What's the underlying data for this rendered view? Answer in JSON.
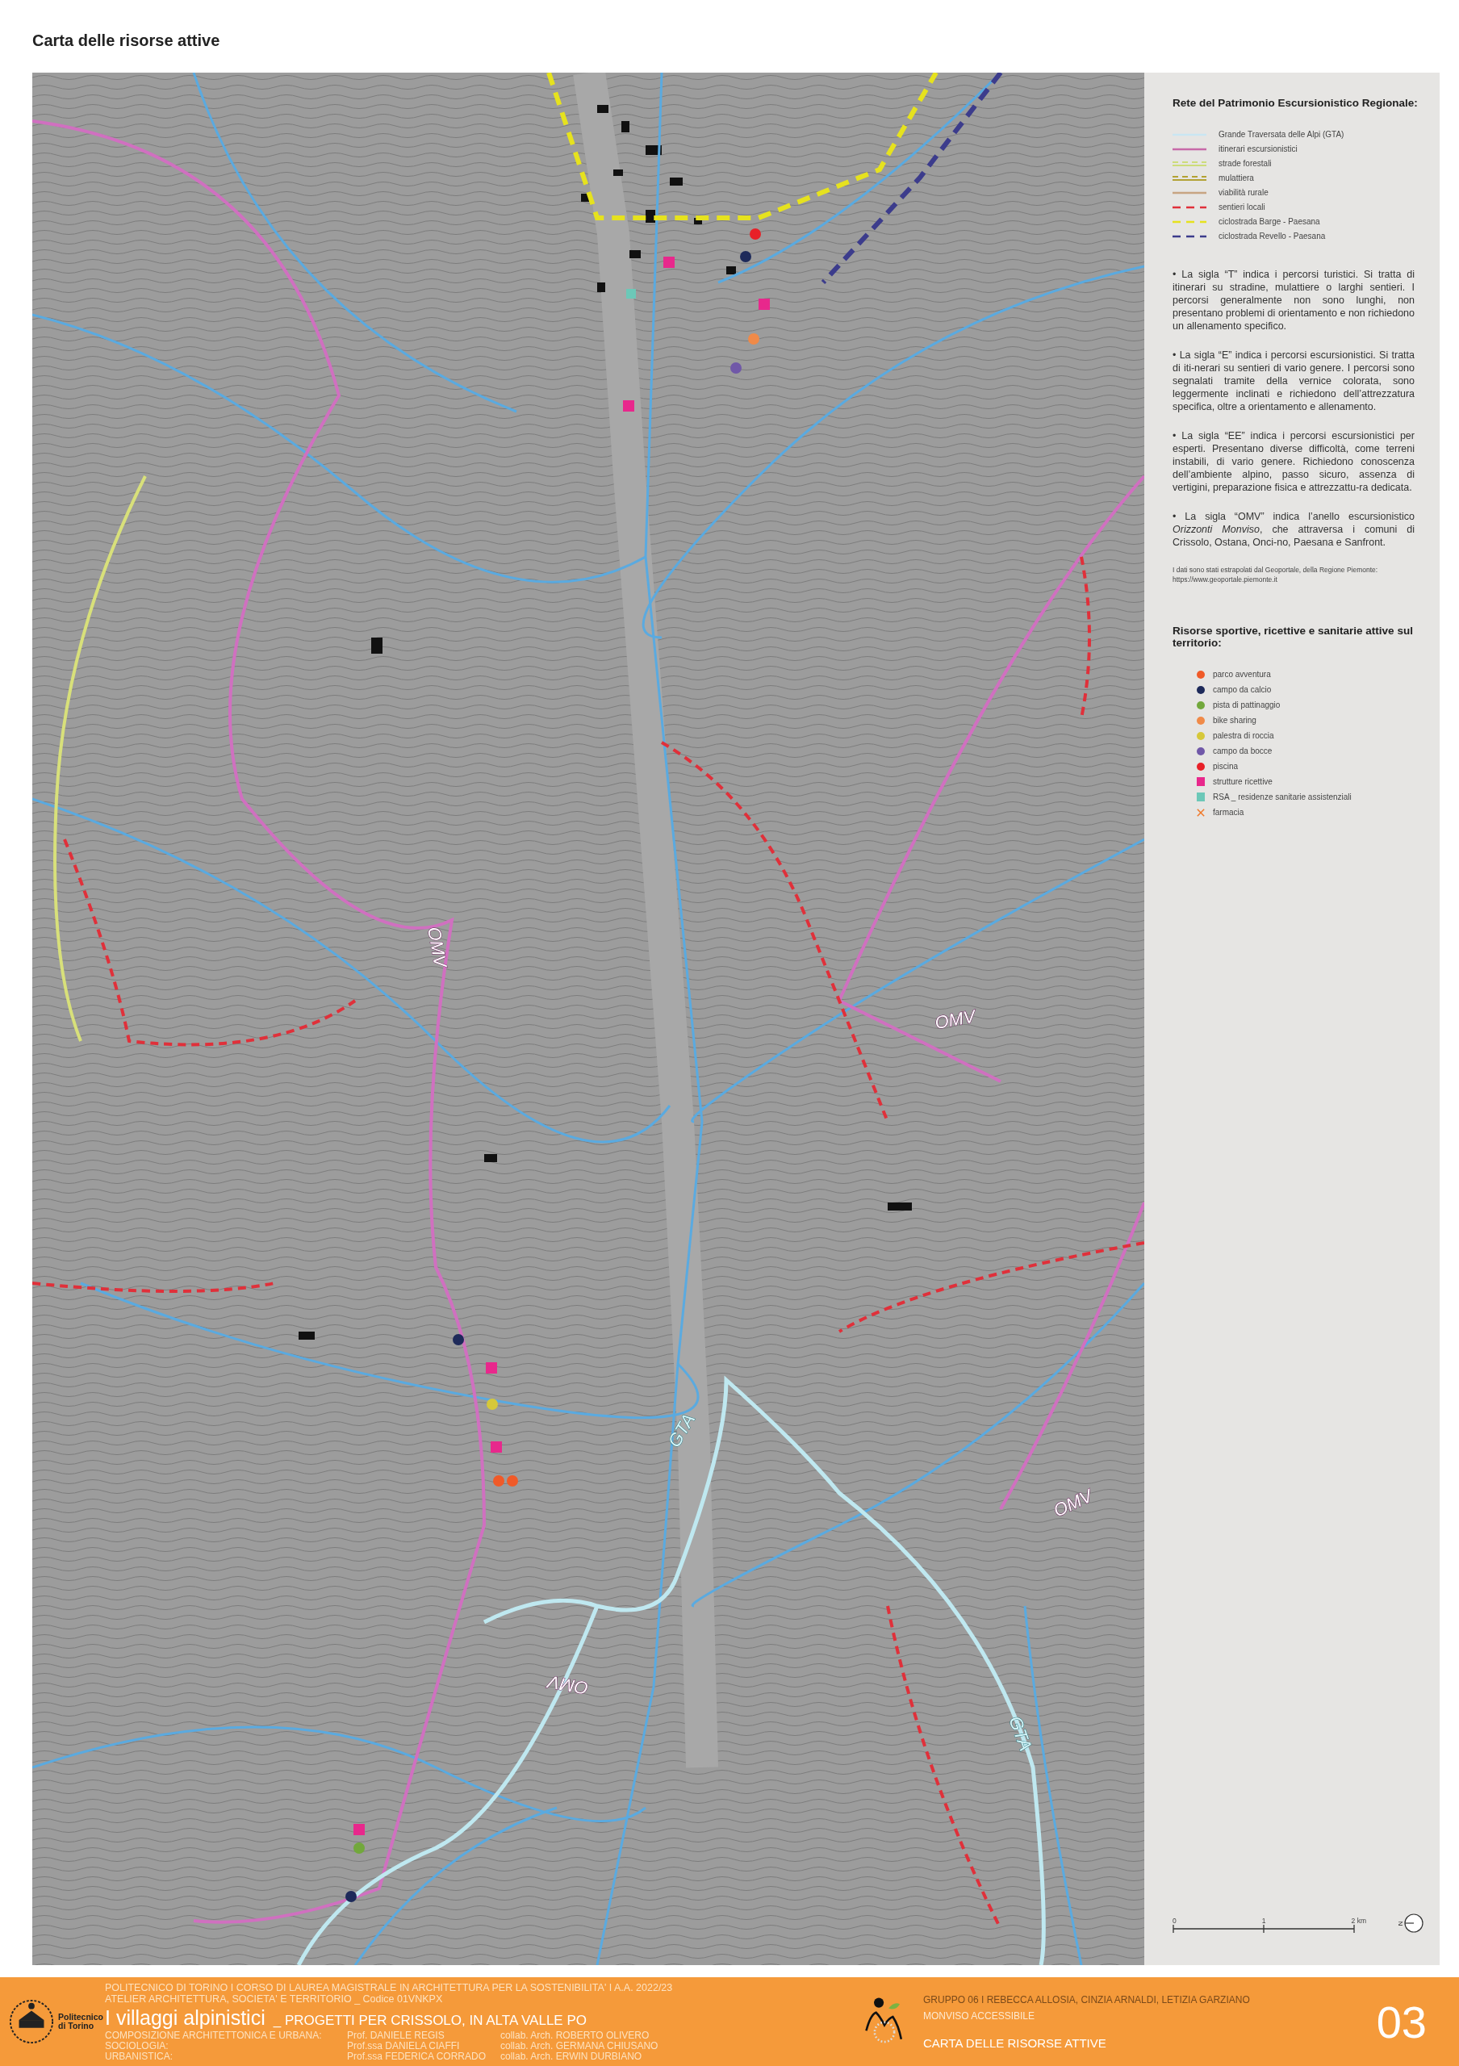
{
  "title": "Carta delle risorse attive",
  "map_labels": [
    "OMV",
    "OMV",
    "OMV",
    "OMV",
    "GTA",
    "GTA"
  ],
  "legend": {
    "network_heading": "Rete del Patrimonio Escursionistico Regionale:",
    "routes": [
      {
        "label": "Grande Traversata delle Alpi (GTA)",
        "kind": "solid",
        "color": "#c9e6f2"
      },
      {
        "label": "itinerari escursionistici",
        "kind": "solid",
        "color": "#c86aa8"
      },
      {
        "label": "strade forestali",
        "kind": "double",
        "color": "#cddc7a"
      },
      {
        "label": "mulattiera",
        "kind": "double",
        "color": "#b3a233"
      },
      {
        "label": "viabilità rurale",
        "kind": "solid",
        "color": "#c7a582"
      },
      {
        "label": "sentieri locali",
        "kind": "dashed",
        "color": "#e0303a"
      },
      {
        "label": "ciclostrada Barge - Paesana",
        "kind": "dashed",
        "color": "#e6e21e"
      },
      {
        "label": "ciclostrada Revello - Paesana",
        "kind": "dashed",
        "color": "#3c3c8c"
      }
    ],
    "notes": [
      "• La sigla “T” indica i percorsi turistici. Si tratta di itinerari su stradine, mulattiere o larghi sentieri. I percorsi generalmente non sono lunghi, non presentano problemi di orientamento e non richiedono un allenamento specifico.",
      "• La sigla “E” indica i percorsi escursionistici. Si tratta di iti-nerari su sentieri di vario genere. I percorsi sono segnalati tramite della vernice colorata, sono leggermente inclinati e richiedono dell’attrezzatura specifica, oltre a orientamento e allenamento.",
      "• La sigla “EE” indica i percorsi escursionistici per esperti. Presentano diverse difficoltà, come terreni instabili, di vario genere. Richiedono conoscenza dell’ambiente alpino, passo sicuro, assenza di vertigini, preparazione fisica e attrezzattu-ra dedicata.",
      "• La sigla “OMV” indica l’anello escursionistico *Orizzonti Monviso*, che attraversa i comuni di Crissolo, Ostana, Onci-no, Paesana e Sanfront."
    ],
    "source": "I dati sono stati estrapolati dal Geoportale, della Regione Piemonte: https://www.geoportale.piemonte.it",
    "resources_heading": "Risorse sportive, ricettive e sanitarie attive sul territorio:",
    "resources": [
      {
        "label": "parco avventura",
        "kind": "circle",
        "color": "#f05a28"
      },
      {
        "label": "campo da calcio",
        "kind": "circle",
        "color": "#1e2a5a"
      },
      {
        "label": "pista di pattinaggio",
        "kind": "circle",
        "color": "#72a83c"
      },
      {
        "label": "bike sharing",
        "kind": "circle",
        "color": "#f08a48"
      },
      {
        "label": "palestra di roccia",
        "kind": "circle",
        "color": "#d6c83a"
      },
      {
        "label": "campo da bocce",
        "kind": "circle",
        "color": "#7058a8"
      },
      {
        "label": "piscina",
        "kind": "circle",
        "color": "#e82028"
      },
      {
        "label": "strutture ricettive",
        "kind": "square",
        "color": "#e8288c"
      },
      {
        "label": "RSA _ residenze sanitarie assistenziali",
        "kind": "square",
        "color": "#6cc8b8"
      },
      {
        "label": "farmacia",
        "kind": "cross",
        "color": "#f07828"
      }
    ],
    "scale": {
      "ticks": [
        "0",
        "1",
        "2 km"
      ],
      "north": "N"
    }
  },
  "footer": {
    "university": "Politecnico di Torino",
    "course_line": "POLITECNICO DI TORINO   I   CORSO DI LAUREA MAGISTRALE IN ARCHITETTURA PER LA SOSTENIBILITA'   I   A.A. 2022/23",
    "atelier_line": "ATELIER ARCHITETTURA, SOCIETA' E TERRITORIO  _  Codice 01VNKPX",
    "project_title": "I villaggi alpinistici",
    "project_subtitle": "_  PROGETTI PER CRISSOLO, IN ALTA VALLE PO",
    "staff": [
      {
        "subject": "COMPOSIZIONE ARCHITETTONICA E URBANA:",
        "professor": "Prof.     DANIELE REGIS",
        "collaborator": "collab. Arch. ROBERTO OLIVERO"
      },
      {
        "subject": "SOCIOLOGIA:",
        "professor": "Prof.ssa DANIELA CIAFFI",
        "collaborator": "collab. Arch. GERMANA CHIUSANO"
      },
      {
        "subject": "URBANISTICA:",
        "professor": "Prof.ssa FEDERICA CORRADO",
        "collaborator": "collab. Arch. ERWIN DURBIANO"
      }
    ],
    "group_line": "GRUPPO  06  I  REBECCA ALLOSIA, CINZIA ARNALDI, LETIZIA GARZIANO",
    "project_name": "MONVISO ACCESSIBILE",
    "sheet_title": "CARTA DELLE RISORSE ATTIVE",
    "sheet_number": "03"
  }
}
